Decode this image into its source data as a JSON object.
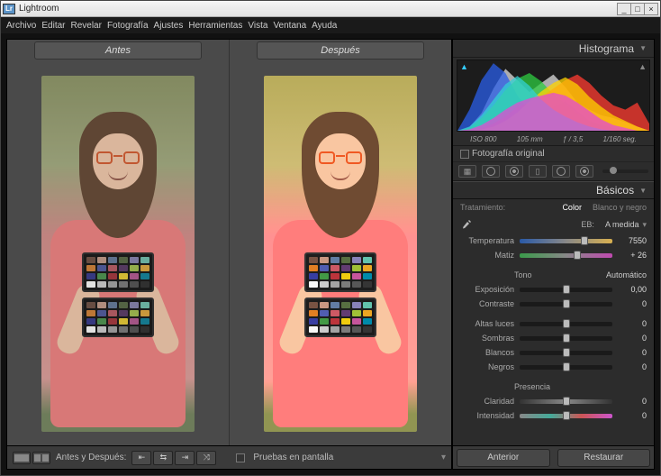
{
  "title": "Lightroom",
  "menu": [
    "Archivo",
    "Editar",
    "Revelar",
    "Fotografía",
    "Ajustes",
    "Herramientas",
    "Vista",
    "Ventana",
    "Ayuda"
  ],
  "compare": {
    "before": "Antes",
    "after": "Después"
  },
  "toolbar": {
    "before_after_label": "Antes y Después:",
    "soft_proof": "Pruebas en pantalla"
  },
  "panel": {
    "histogram_title": "Histograma",
    "exif": {
      "iso": "ISO 800",
      "focal": "105 mm",
      "aperture": "ƒ / 3,5",
      "shutter": "1/160 seg."
    },
    "original_photo": "Fotografía original",
    "basics_title": "Básicos",
    "treatment": {
      "label": "Tratamiento:",
      "color": "Color",
      "bw": "Blanco y negro"
    },
    "wb": {
      "label": "EB:",
      "preset": "A medida"
    },
    "sliders": {
      "temperature": {
        "label": "Temperatura",
        "value": "7550",
        "pos": 70
      },
      "tint": {
        "label": "Matiz",
        "value": "+ 26",
        "pos": 62
      },
      "tone_head": "Tono",
      "auto": "Automático",
      "exposure": {
        "label": "Exposición",
        "value": "0,00",
        "pos": 50
      },
      "contrast": {
        "label": "Contraste",
        "value": "0",
        "pos": 50
      },
      "highlights": {
        "label": "Altas luces",
        "value": "0",
        "pos": 50
      },
      "shadows": {
        "label": "Sombras",
        "value": "0",
        "pos": 50
      },
      "whites": {
        "label": "Blancos",
        "value": "0",
        "pos": 50
      },
      "blacks": {
        "label": "Negros",
        "value": "0",
        "pos": 50
      },
      "presence_head": "Presencia",
      "clarity": {
        "label": "Claridad",
        "value": "0",
        "pos": 50
      },
      "vibrance": {
        "label": "Intensidad",
        "value": "0",
        "pos": 50
      }
    },
    "footer": {
      "previous": "Anterior",
      "reset": "Restaurar"
    }
  },
  "checker_colors": [
    "#735244",
    "#c29682",
    "#627a9d",
    "#576c43",
    "#8580b1",
    "#67bdaa",
    "#d67e2c",
    "#505ba6",
    "#c15a63",
    "#5e3c6c",
    "#9dbc40",
    "#e0a32e",
    "#383d96",
    "#469449",
    "#af363c",
    "#e7c71f",
    "#bb5695",
    "#0885a1",
    "#f3f3f2",
    "#c8c8c8",
    "#a0a0a0",
    "#7a7a79",
    "#555555",
    "#343434"
  ],
  "chart_data": {
    "type": "area",
    "title": "Histograma",
    "xlabel": "",
    "ylabel": "",
    "xlim": [
      0,
      255
    ],
    "ylim": [
      0,
      100
    ],
    "series": [
      {
        "name": "Luminance",
        "color": "#dddddd",
        "values": [
          0,
          5,
          25,
          60,
          88,
          72,
          55,
          68,
          80,
          62,
          40,
          30,
          22,
          18,
          12,
          6,
          0
        ]
      },
      {
        "name": "Blue",
        "color": "#2a5ee8",
        "values": [
          0,
          30,
          72,
          96,
          82,
          50,
          28,
          22,
          34,
          42,
          28,
          14,
          8,
          4,
          2,
          0,
          0
        ]
      },
      {
        "name": "Green",
        "color": "#2ecc40",
        "values": [
          0,
          4,
          18,
          36,
          58,
          74,
          82,
          70,
          52,
          38,
          24,
          14,
          8,
          4,
          0,
          0,
          0
        ]
      },
      {
        "name": "Red",
        "color": "#ff3b30",
        "values": [
          0,
          0,
          4,
          10,
          20,
          34,
          40,
          48,
          60,
          72,
          80,
          68,
          50,
          36,
          30,
          40,
          10
        ]
      },
      {
        "name": "Yellow",
        "color": "#ffd400",
        "values": [
          0,
          0,
          2,
          6,
          14,
          26,
          42,
          56,
          68,
          76,
          66,
          48,
          34,
          22,
          14,
          6,
          0
        ]
      },
      {
        "name": "Cyan",
        "color": "#33d0d6",
        "values": [
          0,
          6,
          22,
          44,
          66,
          78,
          64,
          44,
          30,
          20,
          12,
          6,
          2,
          0,
          0,
          0,
          0
        ]
      },
      {
        "name": "Magenta",
        "color": "#e34bd0",
        "values": [
          0,
          2,
          8,
          18,
          30,
          40,
          46,
          50,
          54,
          50,
          40,
          28,
          16,
          8,
          4,
          0,
          0
        ]
      }
    ]
  }
}
